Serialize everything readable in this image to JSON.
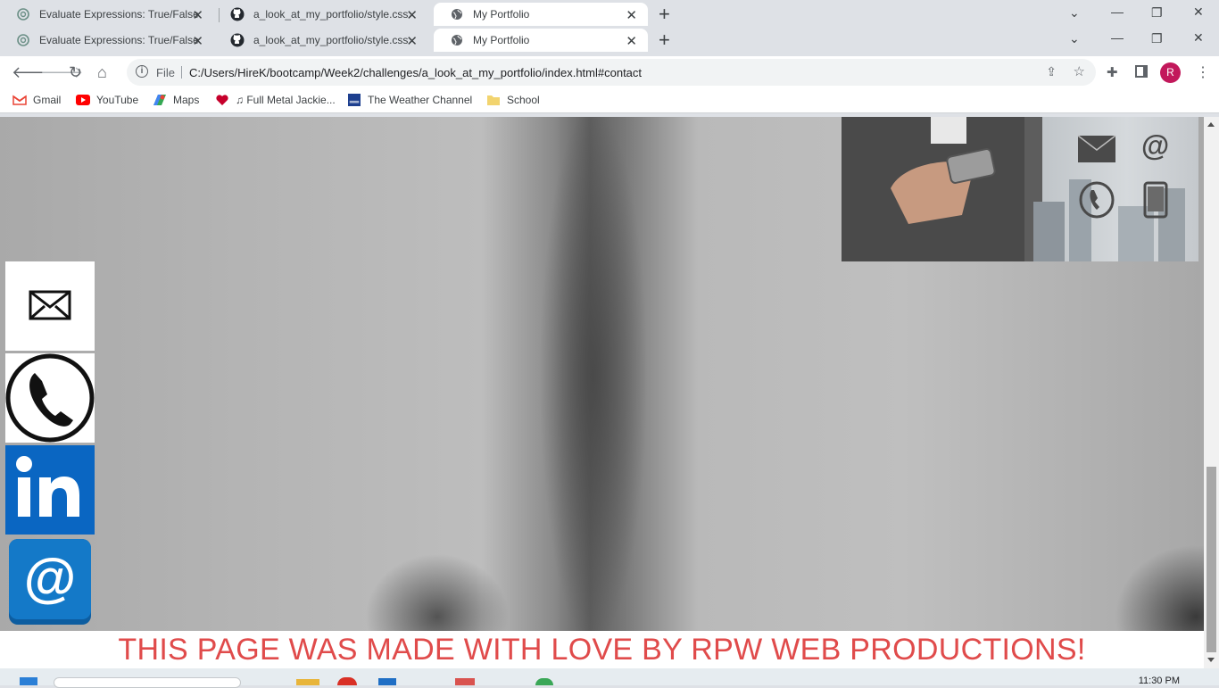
{
  "tabs_row1": [
    {
      "label": "Evaluate Expressions: True/False",
      "icon": "chatgpt-icon"
    },
    {
      "label": "a_look_at_my_portfolio/style.css",
      "icon": "github-icon"
    },
    {
      "label": "My Portfolio",
      "icon": "globe-icon"
    }
  ],
  "tabs_row2": [
    {
      "label": "Evaluate Expressions: True/False",
      "icon": "chatgpt-icon"
    },
    {
      "label": "a_look_at_my_portfolio/style.css",
      "icon": "github-icon"
    },
    {
      "label": "My Portfolio",
      "icon": "globe-icon"
    }
  ],
  "address": {
    "scheme_label": "File",
    "url": "C:/Users/HireK/bootcamp/Week2/challenges/a_look_at_my_portfolio/index.html#contact"
  },
  "profile_initial": "R",
  "bookmarks": [
    {
      "label": "Gmail",
      "icon": "gmail-icon"
    },
    {
      "label": "YouTube",
      "icon": "youtube-icon"
    },
    {
      "label": "Maps",
      "icon": "maps-icon"
    },
    {
      "label": "♫ Full Metal Jackie...",
      "icon": "iheart-icon"
    },
    {
      "label": "The Weather Channel",
      "icon": "weather-icon"
    },
    {
      "label": "School",
      "icon": "folder-icon"
    }
  ],
  "page": {
    "footer_text": "THIS PAGE WAS MADE WITH LOVE BY RPW WEB PRODUCTIONS!",
    "contact_icons": [
      "envelope-icon",
      "phone-icon",
      "linkedin-icon",
      "at-sign-icon"
    ],
    "header_image_icons": [
      "envelope-icon",
      "at-sign-icon",
      "phone-icon",
      "mobile-icon"
    ]
  },
  "clock": "11:30 PM",
  "colors": {
    "footer_text": "#e04b4b",
    "linkedin": "#0a66c2",
    "profile": "#c2185b"
  }
}
